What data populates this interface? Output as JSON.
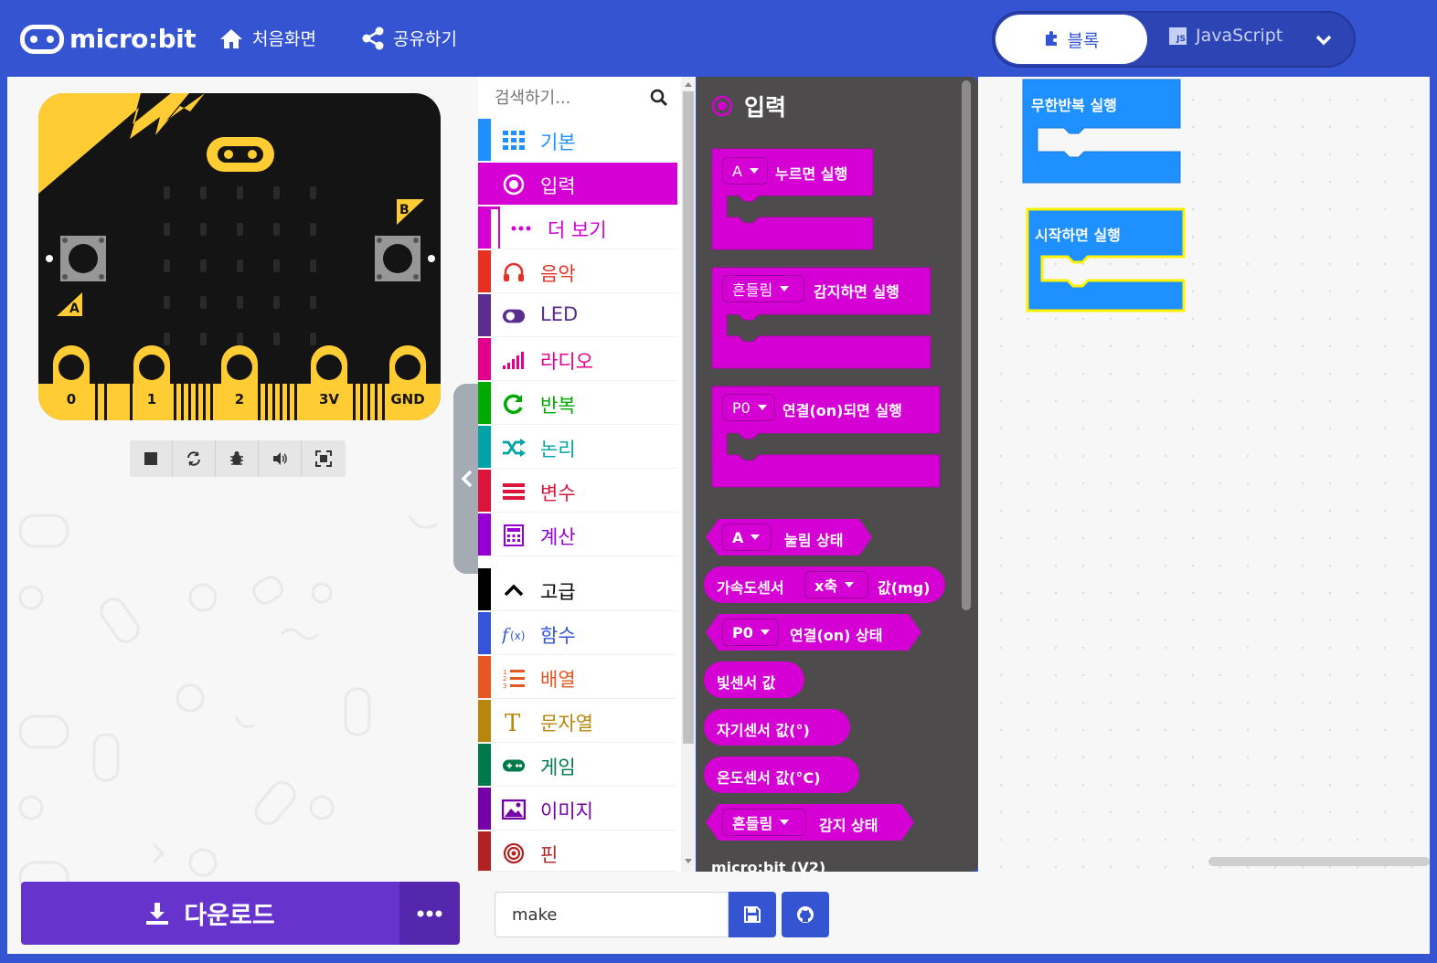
{
  "header": {
    "logo_text": "micro:bit",
    "home_label": "처음화면",
    "share_label": "공유하기",
    "blocks_label": "블록",
    "javascript_label": "JavaScript",
    "js_badge": "JS"
  },
  "simulator": {
    "button_a": "A",
    "button_b": "B",
    "pins": [
      "0",
      "1",
      "2",
      "3V",
      "GND"
    ],
    "download_label": "다운로드",
    "more_label": "..."
  },
  "toolbox": {
    "search_placeholder": "검색하기...",
    "items": [
      {
        "label": "기본",
        "color": "#1E90FF"
      },
      {
        "label": "입력",
        "color": "#D400D4",
        "selected": true
      },
      {
        "label": "더 보기",
        "color": "#D400D4"
      },
      {
        "label": "음악",
        "color": "#E63022"
      },
      {
        "label": "LED",
        "color": "#5C2D91"
      },
      {
        "label": "라디오",
        "color": "#E3008C"
      },
      {
        "label": "반복",
        "color": "#00AA00"
      },
      {
        "label": "논리",
        "color": "#00A4A6"
      },
      {
        "label": "변수",
        "color": "#DC143C"
      },
      {
        "label": "계산",
        "color": "#9400D3"
      },
      {
        "label": "고급",
        "color": "#000000"
      },
      {
        "label": "함수",
        "color": "#3455DB"
      },
      {
        "label": "배열",
        "color": "#E65722"
      },
      {
        "label": "문자열",
        "color": "#B8860B"
      },
      {
        "label": "게임",
        "color": "#007A4B"
      },
      {
        "label": "이미지",
        "color": "#7600A8"
      },
      {
        "label": "핀",
        "color": "#B22222"
      }
    ]
  },
  "flyout": {
    "title": "입력",
    "blocks": {
      "on_button": {
        "dropdown": "A",
        "text": "누르면 실행"
      },
      "on_gesture": {
        "dropdown": "흔들림",
        "text": "감지하면 실행"
      },
      "on_pin": {
        "dropdown": "P0",
        "text": "연결(on)되면 실행"
      },
      "button_pressed": {
        "dropdown": "A",
        "text": "눌림 상태"
      },
      "acceleration": {
        "prefix": "가속도센서",
        "dropdown": "x축",
        "suffix": "값(mg)"
      },
      "pin_pressed": {
        "dropdown": "P0",
        "text": "연결(on) 상태"
      },
      "light_level": "빛센서 값",
      "compass": "자기센서 값(°)",
      "temperature": "온도센서 값(°C)",
      "gesture": {
        "dropdown": "흔들림",
        "text": "감지 상태"
      }
    },
    "bottom_label": "micro:bit (V2)"
  },
  "workspace": {
    "forever_label": "무한반복 실행",
    "on_start_label": "시작하면 실행"
  },
  "bottom": {
    "project_name": "make"
  },
  "colors": {
    "brand": "#3454D1",
    "input_category": "#D400D4",
    "basic_block": "#1E90FF",
    "download": "#6633CC"
  }
}
